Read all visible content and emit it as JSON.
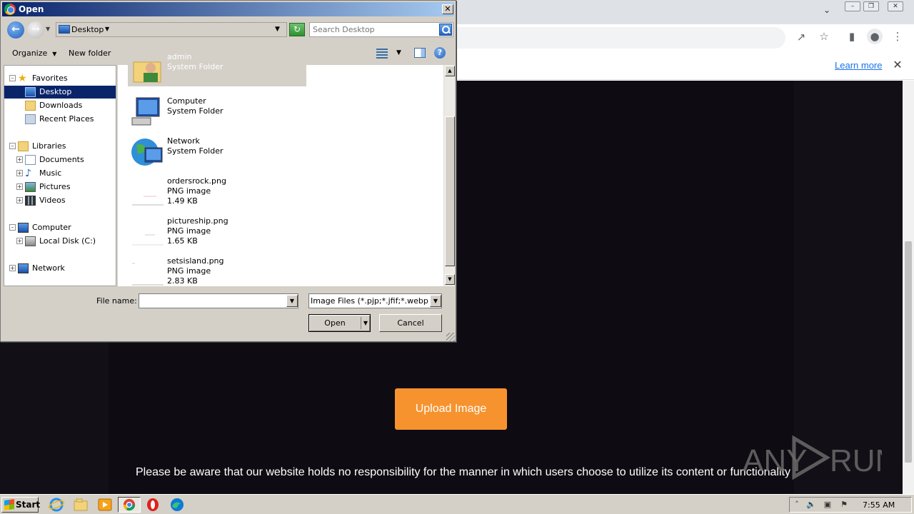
{
  "browser": {
    "infobar": {
      "learn_more": "Learn more",
      "close_icon": "close-icon"
    },
    "toolbar_icons": [
      "share-icon",
      "star-icon",
      "side-panel-icon",
      "profile-icon",
      "kebab-menu-icon"
    ]
  },
  "webpage": {
    "upload_button": "Upload Image",
    "disclaimer": "Please be aware that our website holds no responsibility for the manner in which users choose to utilize its content or functionality",
    "watermark": "ANY RUN",
    "accent": "#f7932f"
  },
  "dialog": {
    "title": "Open",
    "address": "Desktop",
    "search_placeholder": "Search Desktop",
    "commands": {
      "organize": "Organize",
      "new_folder": "New folder"
    },
    "nav_tree": [
      {
        "label": "Favorites"
      },
      {
        "label": "Desktop"
      },
      {
        "label": "Downloads"
      },
      {
        "label": "Recent Places"
      },
      {
        "label": "Libraries"
      },
      {
        "label": "Documents"
      },
      {
        "label": "Music"
      },
      {
        "label": "Pictures"
      },
      {
        "label": "Videos"
      },
      {
        "label": "Computer"
      },
      {
        "label": "Local Disk (C:)"
      },
      {
        "label": "Network"
      }
    ],
    "files": [
      {
        "name": "admin",
        "type": "System Folder",
        "size": ""
      },
      {
        "name": "Computer",
        "type": "System Folder",
        "size": ""
      },
      {
        "name": "Network",
        "type": "System Folder",
        "size": ""
      },
      {
        "name": "ordersrock.png",
        "type": "PNG image",
        "size": "1.49 KB"
      },
      {
        "name": "pictureship.png",
        "type": "PNG image",
        "size": "1.65 KB"
      },
      {
        "name": "setsisland.png",
        "type": "PNG image",
        "size": "2.83 KB"
      }
    ],
    "filename_label": "File name:",
    "filename_value": "",
    "filetype": "Image Files (*.pjp;*.jfif;*.webp;*",
    "open_button": "Open",
    "cancel_button": "Cancel"
  },
  "taskbar": {
    "start": "Start",
    "clock": "7:55 AM"
  }
}
